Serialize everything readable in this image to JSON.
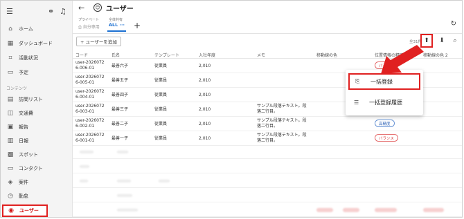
{
  "sidebar": {
    "top_icons": [
      "hamburger-icon",
      "link-icon",
      "bell-icon"
    ],
    "items_main": [
      {
        "label": "ホーム",
        "icon": "⌂"
      },
      {
        "label": "ダッシュボード",
        "icon": "▦"
      },
      {
        "label": "活動状況",
        "icon": "⌗"
      },
      {
        "label": "予定",
        "icon": "▭"
      }
    ],
    "section_label": "コンテンツ",
    "items_contents": [
      {
        "label": "訪問リスト",
        "icon": "▤"
      },
      {
        "label": "交通費",
        "icon": "◫"
      },
      {
        "label": "報告",
        "icon": "▣"
      },
      {
        "label": "日報",
        "icon": "▥"
      },
      {
        "label": "スポット",
        "icon": "▩"
      },
      {
        "label": "コンタクト",
        "icon": "▭"
      },
      {
        "label": "案件",
        "icon": "◈"
      },
      {
        "label": "勤怠",
        "icon": "◷"
      }
    ],
    "active_item": {
      "label": "ユーザー",
      "icon": "◉"
    }
  },
  "header": {
    "title": "ユーザー",
    "private_label": "プライベート",
    "private_value": "自分専用",
    "shared_label": "全体共有",
    "tab_all": "ALL ···",
    "add_tab": "+"
  },
  "toolbar": {
    "add_button": "+ ユーザーを追加",
    "count": "全31件"
  },
  "table": {
    "columns": [
      "コード",
      "氏名",
      "テンプレート",
      "入社年度",
      "メモ",
      "移動線の色",
      "位置情報の精度",
      "移動線の色 2"
    ],
    "rows": [
      {
        "code": [
          "user-2026072",
          "6-006-01"
        ],
        "name": "最善六子",
        "template": "従業員",
        "year": "2,010",
        "memo": [],
        "accuracy": "バランス",
        "accuracy_style": "red"
      },
      {
        "code": [
          "user-2026072",
          "6-005-01"
        ],
        "name": "最善五子",
        "template": "従業員",
        "year": "2,010",
        "memo": [],
        "accuracy": "",
        "accuracy_style": ""
      },
      {
        "code": [
          "user-2026072",
          "6-004-01"
        ],
        "name": "最善四子",
        "template": "従業員",
        "year": "2,010",
        "memo": [],
        "accuracy": "",
        "accuracy_style": ""
      },
      {
        "code": [
          "user-2026072",
          "6-003-01"
        ],
        "name": "最善三子",
        "template": "従業員",
        "year": "2,010",
        "memo": [
          "サンプル段落テキスト。段",
          "落二行目。"
        ],
        "accuracy": "",
        "accuracy_style": ""
      },
      {
        "code": [
          "user-2026072",
          "6-002-01"
        ],
        "name": "最善二子",
        "template": "従業員",
        "year": "2,010",
        "memo": [
          "サンプル段落テキスト。段",
          "落二行目。"
        ],
        "accuracy": "高精度",
        "accuracy_style": "blue"
      },
      {
        "code": [
          "user-2026072",
          "6-001-01"
        ],
        "name": "最善一子",
        "template": "従業員",
        "year": "2,010",
        "memo": [
          "サンプル段落テキスト。段",
          "落二行目。"
        ],
        "accuracy": "バランス",
        "accuracy_style": "red"
      }
    ]
  },
  "menu": {
    "items": [
      {
        "label": "一括登録",
        "icon": "upload-file-icon"
      },
      {
        "label": "一括登録履歴",
        "icon": "history-list-icon"
      }
    ]
  },
  "colors": {
    "accent": "#1a6fd1",
    "highlight": "#e02020"
  }
}
